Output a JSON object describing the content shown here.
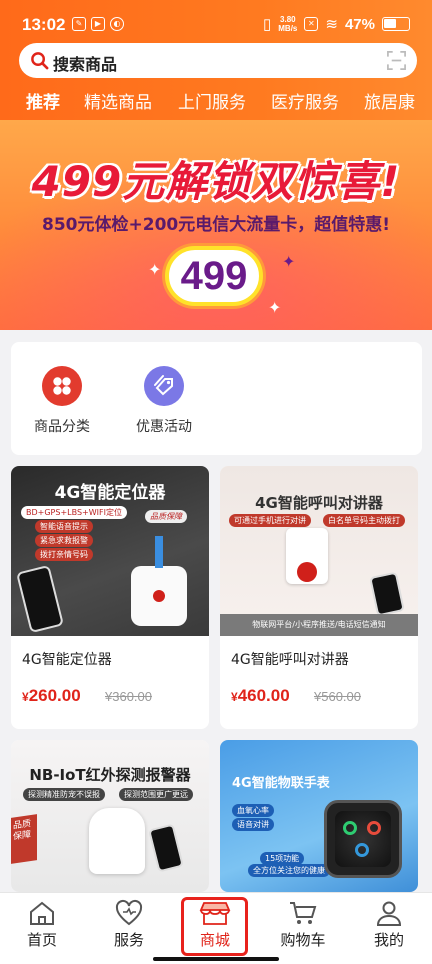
{
  "status_bar": {
    "time": "13:02",
    "net_speed_top": "3.80",
    "net_speed_bottom": "MB/s",
    "battery": "47%"
  },
  "search": {
    "placeholder": "搜索商品"
  },
  "tabs": [
    "推荐",
    "精选商品",
    "上门服务",
    "医疗服务",
    "旅居康"
  ],
  "banner": {
    "headline": "499元解锁双惊喜!",
    "subline": "850元体检+200元电信大流量卡，超值特惠!",
    "badge": "499"
  },
  "quick_entries": [
    {
      "label": "商品分类",
      "color": "#e23b2e",
      "icon": "grid-icon"
    },
    {
      "label": "优惠活动",
      "color": "#7b78e6",
      "icon": "coupon-icon"
    }
  ],
  "products": [
    {
      "name": "4G智能定位器",
      "price_symbol": "¥",
      "price": "260.00",
      "old_price": "¥360.00",
      "image": {
        "title": "4G智能定位器",
        "pills": [
          "BD+GPS+LBS+WIFI定位",
          "智能语音提示",
          "紧急求救报警",
          "拨打亲情号码"
        ],
        "tag": "品质保障"
      }
    },
    {
      "name": "4G智能呼叫对讲器",
      "price_symbol": "¥",
      "price": "460.00",
      "old_price": "¥560.00",
      "image": {
        "title": "4G智能呼叫对讲器",
        "pills": [
          "可通过手机进行对讲",
          "白名单号码主动拨打"
        ],
        "footer": "物联网平台/小程序推送/电话短信通知"
      }
    },
    {
      "name": "",
      "price_symbol": "",
      "price": "",
      "old_price": "",
      "image": {
        "title": "NB-IoT红外探测报警器",
        "pills": [
          "探测精准防宠不误报",
          "探测范围更广更远"
        ],
        "tag": "品质保障"
      }
    },
    {
      "name": "",
      "price_symbol": "",
      "price": "",
      "old_price": "",
      "image": {
        "title": "4G智能物联手表",
        "pills": [
          "血氧心率",
          "语音对讲",
          "15项功能",
          "全方位关注您的健康"
        ]
      }
    }
  ],
  "bottom_nav": [
    {
      "label": "首页",
      "icon": "home-icon"
    },
    {
      "label": "服务",
      "icon": "heart-icon"
    },
    {
      "label": "商城",
      "icon": "store-icon",
      "active": true
    },
    {
      "label": "购物车",
      "icon": "cart-icon"
    },
    {
      "label": "我的",
      "icon": "person-icon"
    }
  ],
  "colors": {
    "header": "#ff7a20",
    "price": "#e0241a",
    "highlight_box": "#e8221c"
  }
}
